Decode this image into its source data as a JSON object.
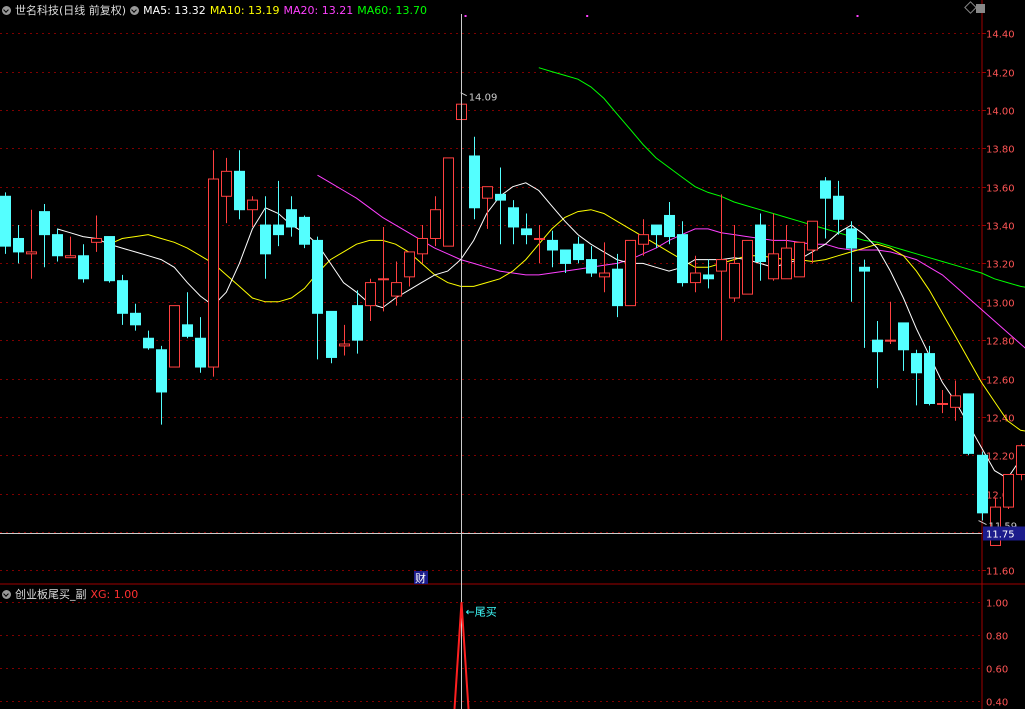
{
  "header": {
    "title": "世名科技(日线 前复权)",
    "ma5": "MA5: 13.32",
    "ma10": "MA10: 13.19",
    "ma20": "MA20: 13.21",
    "ma60": "MA60: 13.70"
  },
  "sub_header": {
    "title": "创业板尾买_副",
    "xg": "XG: 1.00"
  },
  "labels": {
    "high_marker": "14.09",
    "low_marker": "11.59",
    "cursor_price": "11.75",
    "fin_marker": "财",
    "signal_marker": "←尾买"
  },
  "colors": {
    "up": "#ff4040",
    "down": "#54ffff",
    "ma5": "#ffffff",
    "ma10": "#ffff00",
    "ma20": "#ff40ff",
    "ma60": "#00ff00",
    "grid": "#7f0000",
    "axis": "#a00000",
    "signal": "#ff2020"
  },
  "chart_data": [
    {
      "type": "candlestick",
      "ylim": [
        11.55,
        14.5
      ],
      "yticks": [
        11.6,
        11.8,
        12.0,
        12.2,
        12.4,
        12.6,
        12.8,
        13.0,
        13.2,
        13.4,
        13.6,
        13.8,
        14.0,
        14.2,
        14.4
      ],
      "candles": [
        [
          13.55,
          13.57,
          13.29,
          13.25
        ],
        [
          13.33,
          13.4,
          13.26,
          13.2
        ],
        [
          13.25,
          13.48,
          13.26,
          13.12
        ],
        [
          13.47,
          13.51,
          13.35,
          13.18
        ],
        [
          13.35,
          13.38,
          13.24,
          13.21
        ],
        [
          13.23,
          13.34,
          13.24,
          13.23
        ],
        [
          13.24,
          13.3,
          13.12,
          13.1
        ],
        [
          13.31,
          13.45,
          13.33,
          13.26
        ],
        [
          13.34,
          13.34,
          13.11,
          13.1
        ],
        [
          13.11,
          13.14,
          12.94,
          12.88
        ],
        [
          12.94,
          12.99,
          12.88,
          12.85
        ],
        [
          12.81,
          12.85,
          12.76,
          12.75
        ],
        [
          12.75,
          12.77,
          12.53,
          12.36
        ],
        [
          12.66,
          12.98,
          12.98,
          12.66
        ],
        [
          12.88,
          13.05,
          12.82,
          12.81
        ],
        [
          12.81,
          12.92,
          12.66,
          12.63
        ],
        [
          12.66,
          13.79,
          13.64,
          12.61
        ],
        [
          13.55,
          13.75,
          13.68,
          13.41
        ],
        [
          13.68,
          13.79,
          13.48,
          13.43
        ],
        [
          13.48,
          13.55,
          13.53,
          13.39
        ],
        [
          13.4,
          13.55,
          13.25,
          13.12
        ],
        [
          13.4,
          13.63,
          13.35,
          13.29
        ],
        [
          13.48,
          13.55,
          13.39,
          13.34
        ],
        [
          13.44,
          13.45,
          13.3,
          13.28
        ],
        [
          13.32,
          13.34,
          12.94,
          12.7
        ],
        [
          12.95,
          12.95,
          12.71,
          12.68
        ],
        [
          12.77,
          12.88,
          12.78,
          12.72
        ],
        [
          12.98,
          13.06,
          12.8,
          12.73
        ],
        [
          12.98,
          13.12,
          13.1,
          12.9
        ],
        [
          13.12,
          13.39,
          13.12,
          12.95
        ],
        [
          13.03,
          13.21,
          13.1,
          12.98
        ],
        [
          13.13,
          13.22,
          13.26,
          13.08
        ],
        [
          13.25,
          13.4,
          13.33,
          13.2
        ],
        [
          13.33,
          13.55,
          13.48,
          13.29
        ],
        [
          13.29,
          13.6,
          13.75,
          13.31
        ],
        [
          13.95,
          14.09,
          14.03,
          13.64
        ],
        [
          13.76,
          13.86,
          13.49,
          13.43
        ],
        [
          13.54,
          13.6,
          13.6,
          13.38
        ],
        [
          13.56,
          13.7,
          13.53,
          13.3
        ],
        [
          13.49,
          13.53,
          13.39,
          13.3
        ],
        [
          13.38,
          13.46,
          13.35,
          13.3
        ],
        [
          13.33,
          13.4,
          13.33,
          13.2
        ],
        [
          13.32,
          13.37,
          13.27,
          13.18
        ],
        [
          13.27,
          13.27,
          13.2,
          13.15
        ],
        [
          13.3,
          13.34,
          13.22,
          13.2
        ],
        [
          13.22,
          13.29,
          13.15,
          13.13
        ],
        [
          13.13,
          13.31,
          13.15,
          13.05
        ],
        [
          13.17,
          13.25,
          12.98,
          12.92
        ],
        [
          12.98,
          13.29,
          13.32,
          12.99
        ],
        [
          13.3,
          13.43,
          13.35,
          13.24
        ],
        [
          13.4,
          13.4,
          13.35,
          13.28
        ],
        [
          13.45,
          13.52,
          13.34,
          13.3
        ],
        [
          13.35,
          13.42,
          13.1,
          13.08
        ],
        [
          13.1,
          13.24,
          13.15,
          13.05
        ],
        [
          13.14,
          13.22,
          13.12,
          13.07
        ],
        [
          13.16,
          13.56,
          13.22,
          12.8
        ],
        [
          13.02,
          13.4,
          13.2,
          13.0
        ],
        [
          13.04,
          13.27,
          13.32,
          13.1
        ],
        [
          13.4,
          13.46,
          13.21,
          13.11
        ],
        [
          13.12,
          13.46,
          13.25,
          13.11
        ],
        [
          13.12,
          13.4,
          13.28,
          13.12
        ],
        [
          13.13,
          13.27,
          13.31,
          13.15
        ],
        [
          13.27,
          13.37,
          13.42,
          13.2
        ],
        [
          13.63,
          13.65,
          13.54,
          13.33
        ],
        [
          13.55,
          13.63,
          13.43,
          13.35
        ],
        [
          13.38,
          13.42,
          13.28,
          13.0
        ],
        [
          13.18,
          13.22,
          13.16,
          12.76
        ],
        [
          12.8,
          12.9,
          12.74,
          12.55
        ],
        [
          12.8,
          13.0,
          12.8,
          12.78
        ],
        [
          12.89,
          12.89,
          12.75,
          12.64
        ],
        [
          12.73,
          12.75,
          12.63,
          12.46
        ],
        [
          12.73,
          12.77,
          12.47,
          12.46
        ],
        [
          12.47,
          12.54,
          12.47,
          12.42
        ],
        [
          12.45,
          12.59,
          12.51,
          12.38
        ],
        [
          12.52,
          12.52,
          12.21,
          12.2
        ],
        [
          12.2,
          12.22,
          11.9,
          11.86
        ],
        [
          11.73,
          11.98,
          11.93,
          11.73
        ],
        [
          11.93,
          12.1,
          12.1,
          11.92
        ],
        [
          12.1,
          12.26,
          12.25,
          12.07
        ],
        [
          12.21,
          12.99,
          12.7,
          12.18
        ]
      ],
      "ma5": [
        13.38,
        13.36,
        13.34,
        13.33,
        13.3,
        13.28,
        13.26,
        13.24,
        13.22,
        13.18,
        13.1,
        13.03,
        12.98,
        13.05,
        13.2,
        13.38,
        13.49,
        13.46,
        13.4,
        13.36,
        13.3,
        13.2,
        13.1,
        13.05,
        12.99,
        12.97,
        13.02,
        13.06,
        13.1,
        13.14,
        13.16,
        13.22,
        13.32,
        13.46,
        13.55,
        13.6,
        13.62,
        13.58,
        13.5,
        13.42,
        13.35,
        13.3,
        13.26,
        13.22,
        13.2,
        13.2,
        13.18,
        13.16,
        13.18,
        13.22,
        13.22,
        13.22,
        13.23,
        13.22,
        13.2,
        13.18,
        13.2,
        13.22,
        13.26,
        13.3,
        13.36,
        13.4,
        13.35,
        13.28,
        13.16,
        13.02,
        12.86,
        12.72,
        12.58,
        12.48,
        12.36,
        12.24,
        12.12,
        12.08,
        12.18,
        12.32
      ],
      "ma10": [
        13.3,
        13.33,
        13.34,
        13.35,
        13.33,
        13.31,
        13.28,
        13.24,
        13.2,
        13.14,
        13.08,
        13.02,
        13.0,
        13.0,
        13.02,
        13.07,
        13.15,
        13.22,
        13.26,
        13.3,
        13.32,
        13.32,
        13.3,
        13.26,
        13.2,
        13.14,
        13.1,
        13.08,
        13.08,
        13.1,
        13.12,
        13.16,
        13.22,
        13.3,
        13.38,
        13.44,
        13.47,
        13.48,
        13.46,
        13.42,
        13.38,
        13.34,
        13.3,
        13.26,
        13.22,
        13.18,
        13.18,
        13.2,
        13.22,
        13.24,
        13.24,
        13.23,
        13.22,
        13.22,
        13.21,
        13.22,
        13.24,
        13.26,
        13.28,
        13.3,
        13.28,
        13.24,
        13.16,
        13.06,
        12.94,
        12.82,
        12.7,
        12.58,
        12.48,
        12.38,
        12.33,
        12.32
      ],
      "ma20": [
        13.66,
        13.62,
        13.58,
        13.54,
        13.49,
        13.44,
        13.4,
        13.36,
        13.32,
        13.28,
        13.25,
        13.22,
        13.2,
        13.18,
        13.16,
        13.15,
        13.14,
        13.14,
        13.15,
        13.16,
        13.17,
        13.18,
        13.19,
        13.2,
        13.22,
        13.25,
        13.28,
        13.32,
        13.35,
        13.38,
        13.38,
        13.36,
        13.35,
        13.34,
        13.33,
        13.32,
        13.32,
        13.31,
        13.3,
        13.3,
        13.28,
        13.27,
        13.27,
        13.27,
        13.26,
        13.24,
        13.22,
        13.18,
        13.14,
        13.08,
        13.02,
        12.96,
        12.9,
        12.84,
        12.78,
        12.72
      ],
      "ma60": [
        14.22,
        14.2,
        14.18,
        14.16,
        14.12,
        14.06,
        13.98,
        13.9,
        13.82,
        13.75,
        13.7,
        13.65,
        13.6,
        13.57,
        13.55,
        13.52,
        13.5,
        13.48,
        13.46,
        13.44,
        13.42,
        13.4,
        13.38,
        13.36,
        13.34,
        13.32,
        13.31,
        13.29,
        13.27,
        13.25,
        13.23,
        13.21,
        13.19,
        13.17,
        13.15,
        13.12,
        13.1,
        13.08,
        13.07
      ]
    },
    {
      "type": "line",
      "ylim": [
        0.35,
        1.05
      ],
      "yticks": [
        0.4,
        0.6,
        0.8,
        1.0
      ],
      "signal_index": 35,
      "values": [
        1.0
      ]
    }
  ]
}
